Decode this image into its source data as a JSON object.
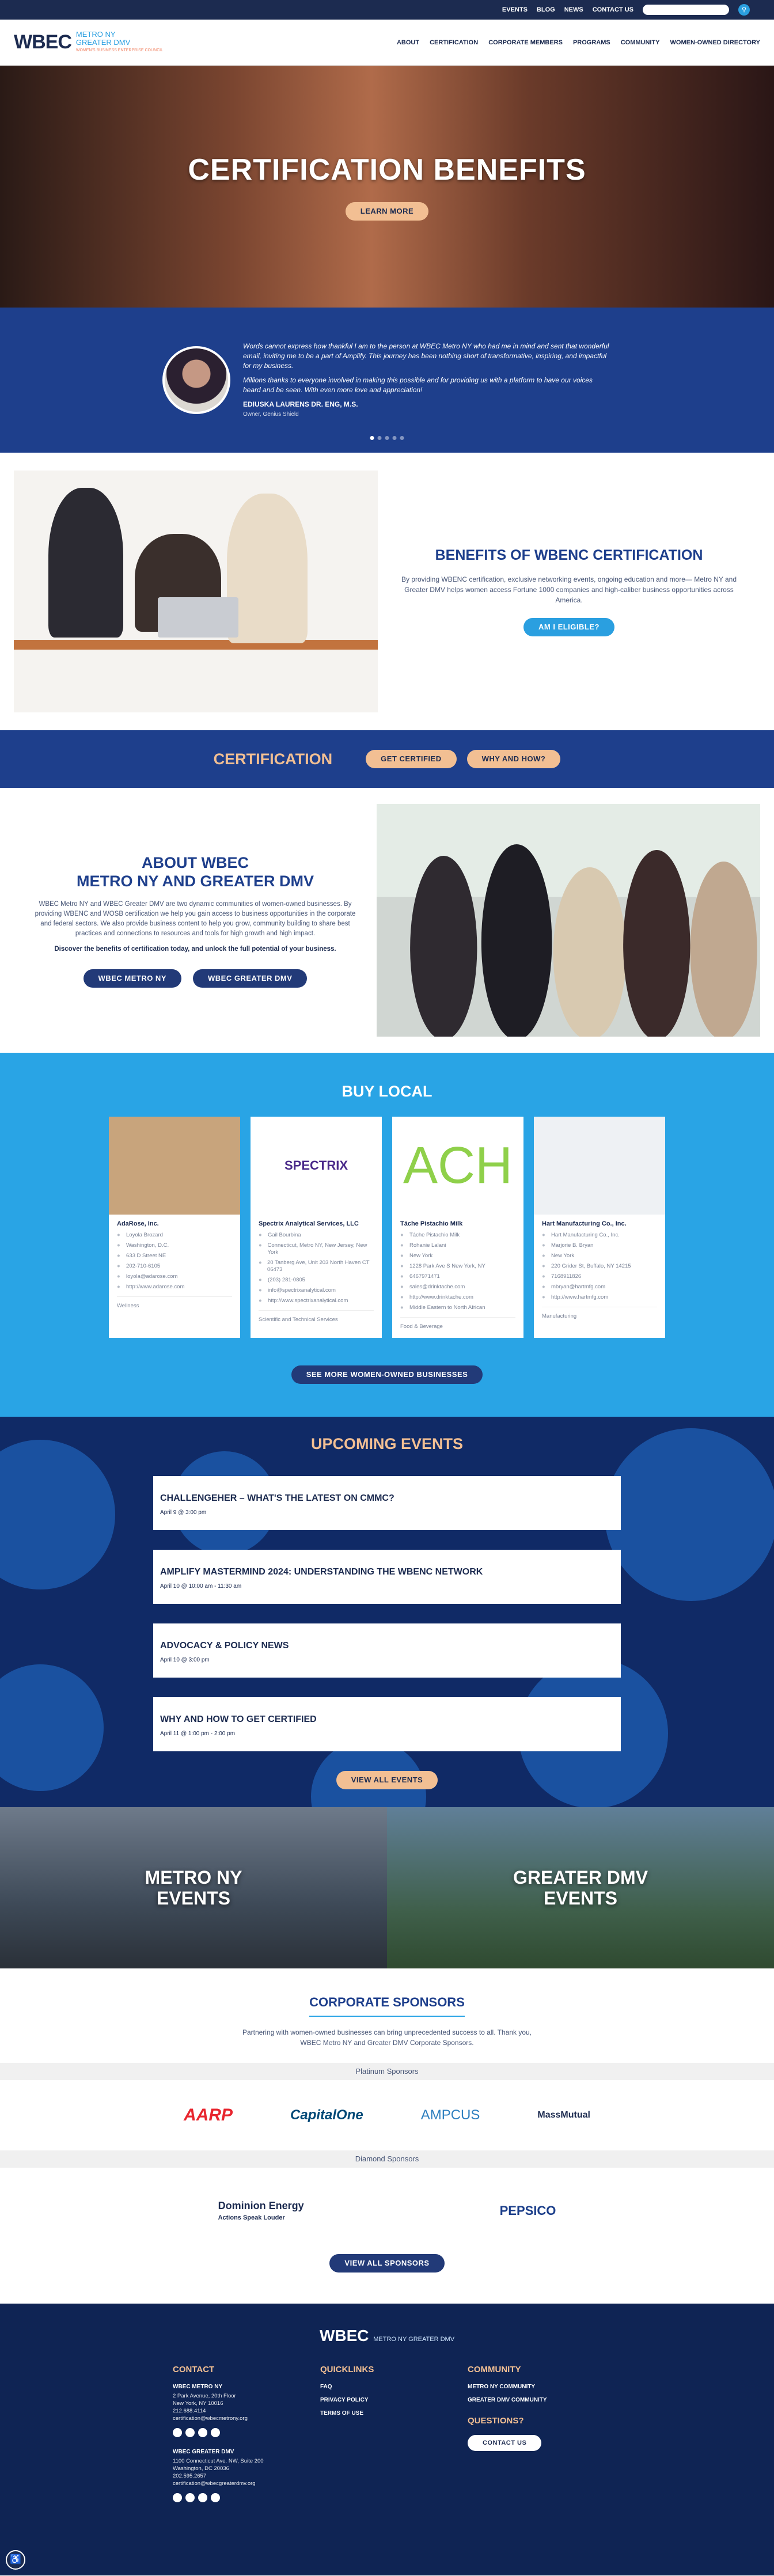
{
  "topbar": {
    "links": [
      "EVENTS",
      "BLOG",
      "NEWS",
      "CONTACT US"
    ],
    "search_icon": "search-icon"
  },
  "nav": {
    "logo_main": "WBEC",
    "logo_sub1": "METRO NY",
    "logo_sub2": "GREATER DMV",
    "logo_tagline": "WOMEN'S BUSINESS ENTERPRISE COUNCIL",
    "items": [
      "ABOUT",
      "CERTIFICATION",
      "CORPORATE MEMBERS",
      "PROGRAMS",
      "COMMUNITY",
      "WOMEN-OWNED DIRECTORY"
    ]
  },
  "hero": {
    "title": "CERTIFICATION BENEFITS",
    "cta": "LEARN MORE"
  },
  "testimonial": {
    "quote1": "Words cannot express how thankful I am to the person at WBEC Metro NY who had me in mind and sent that wonderful email, inviting me to be a part of Amplify. This journey has been nothing short of transformative, inspiring, and impactful for my business.",
    "quote2": "Millions thanks to everyone involved in making this possible and for providing us with a platform to have our voices heard and be seen. With even more love and appreciation!",
    "name": "EDIUSKA LAURENS DR. ENG, M.S.",
    "role": "Owner, Genius Shield"
  },
  "benefits": {
    "title": "BENEFITS OF WBENC CERTIFICATION",
    "text": "By providing WBENC certification, exclusive networking events, ongoing education and more— Metro NY and Greater DMV helps women access Fortune 1000 companies and high-caliber business opportunities across America.",
    "cta": "AM I ELIGIBLE?"
  },
  "cert": {
    "title": "CERTIFICATION",
    "btn1": "GET CERTIFIED",
    "btn2": "WHY AND HOW?"
  },
  "about": {
    "title1": "ABOUT WBEC",
    "title2": "METRO NY AND GREATER DMV",
    "text": "WBEC Metro NY and WBEC Greater DMV are two dynamic communities of women-owned businesses. By providing WBENC and WOSB certification we help you gain access to business opportunities in the corporate and federal sectors. We also provide business content to help you grow, community building to share best practices and connections to resources and tools for high growth and high impact.",
    "bold": "Discover the benefits of certification today, and unlock the full potential of your business.",
    "btn1": "WBEC METRO NY",
    "btn2": "WBEC GREATER DMV"
  },
  "buy_local": {
    "title": "BUY LOCAL",
    "cards": [
      {
        "name": "AdaRose, Inc.",
        "logo": "",
        "rows": [
          "Loyola Brozard",
          "Washington, D.C.",
          "633 D Street NE",
          "202-710-6105",
          "loyola@adarose.com",
          "http://www.adarose.com"
        ],
        "category": "Wellness"
      },
      {
        "name": "Spectrix Analytical Services, LLC",
        "logo": "SPECTRIX",
        "rows": [
          "Gail Bourbina",
          "Connecticut, Metro NY, New Jersey, New York",
          "20 Tanberg Ave, Unit 203 North Haven CT 06473",
          "(203) 281-0805",
          "info@spectrixanalytical.com",
          "http://www.spectrixanalytical.com"
        ],
        "category": "Scientific and Technical Services"
      },
      {
        "name": "Táche Pistachio Milk",
        "logo": "ACH",
        "rows": [
          "Táche Pistachio Milk",
          "Rohanie Lalani",
          "New York",
          "1228 Park Ave S New York, NY",
          "6467971471",
          "sales@drinktache.com",
          "http://www.drinktache.com",
          "Middle Eastern to North African"
        ],
        "category": "Food & Beverage"
      },
      {
        "name": "Hart Manufacturing Co., Inc.",
        "logo": "",
        "rows": [
          "Hart Manufacturing Co., Inc.",
          "Marjorie B. Bryan",
          "New York",
          "220 Grider St, Buffalo, NY 14215",
          "7168911826",
          "mbryan@hartmfg.com",
          "http://www.hartmfg.com"
        ],
        "category": "Manufacturing"
      }
    ],
    "cta": "SEE MORE WOMEN-OWNED BUSINESSES"
  },
  "events": {
    "title": "UPCOMING EVENTS",
    "items": [
      {
        "title": "CHALLENGEHER – WHAT'S THE LATEST ON CMMC?",
        "date": "April 9 @ 3:00 pm"
      },
      {
        "title": "AMPLIFY MASTERMIND 2024: UNDERSTANDING THE WBENC NETWORK",
        "date": "April 10 @ 10:00 am - 11:30 am"
      },
      {
        "title": "ADVOCACY & POLICY NEWS",
        "date": "April 10 @ 3:00 pm"
      },
      {
        "title": "WHY AND HOW TO GET CERTIFIED",
        "date": "April 11 @ 1:00 pm - 2:00 pm"
      }
    ],
    "cta": "VIEW ALL EVENTS"
  },
  "cities": {
    "ny1": "METRO NY",
    "ny2": "EVENTS",
    "dc1": "GREATER DMV",
    "dc2": "EVENTS"
  },
  "sponsors": {
    "title": "CORPORATE SPONSORS",
    "intro": "Partnering with women-owned businesses can bring unprecedented success to all. Thank you, WBEC Metro NY and Greater DMV Corporate Sponsors.",
    "platinum_label": "Platinum Sponsors",
    "platinum": [
      "AARP",
      "CapitalOne",
      "AMPCUS",
      "MassMutual"
    ],
    "diamond_label": "Diamond Sponsors",
    "diamond": [
      "Dominion Energy",
      "PEPSICO"
    ],
    "diamond_tagline": "Actions Speak Louder",
    "cta": "VIEW ALL SPONSORS"
  },
  "footer": {
    "logo": "WBEC",
    "logo_sub": "METRO NY GREATER DMV",
    "contact_title": "CONTACT",
    "ny_title": "WBEC METRO NY",
    "ny_addr1": "2 Park Avenue, 20th Floor",
    "ny_addr2": "New York, NY 10016",
    "ny_phone": "212.688.4114",
    "ny_email": "certification@wbecmetrony.org",
    "dmv_title": "WBEC GREATER DMV",
    "dmv_addr1": "1100 Connecticut Ave. NW, Suite 200",
    "dmv_addr2": "Washington, DC 20036",
    "dmv_phone": "202.595.2657",
    "dmv_email": "certification@wbecgreaterdmv.org",
    "quick_title": "QUICKLINKS",
    "quick": [
      "FAQ",
      "PRIVACY POLICY",
      "TERMS OF USE"
    ],
    "community_title": "COMMUNITY",
    "community": [
      "METRO NY COMMUNITY",
      "GREATER DMV COMMUNITY"
    ],
    "questions": "QUESTIONS?",
    "contact_btn": "CONTACT US"
  },
  "colors": {
    "navy": "#1c2b50",
    "royal": "#1e3f8c",
    "sky": "#29a4e5",
    "peach": "#f2bf93"
  }
}
